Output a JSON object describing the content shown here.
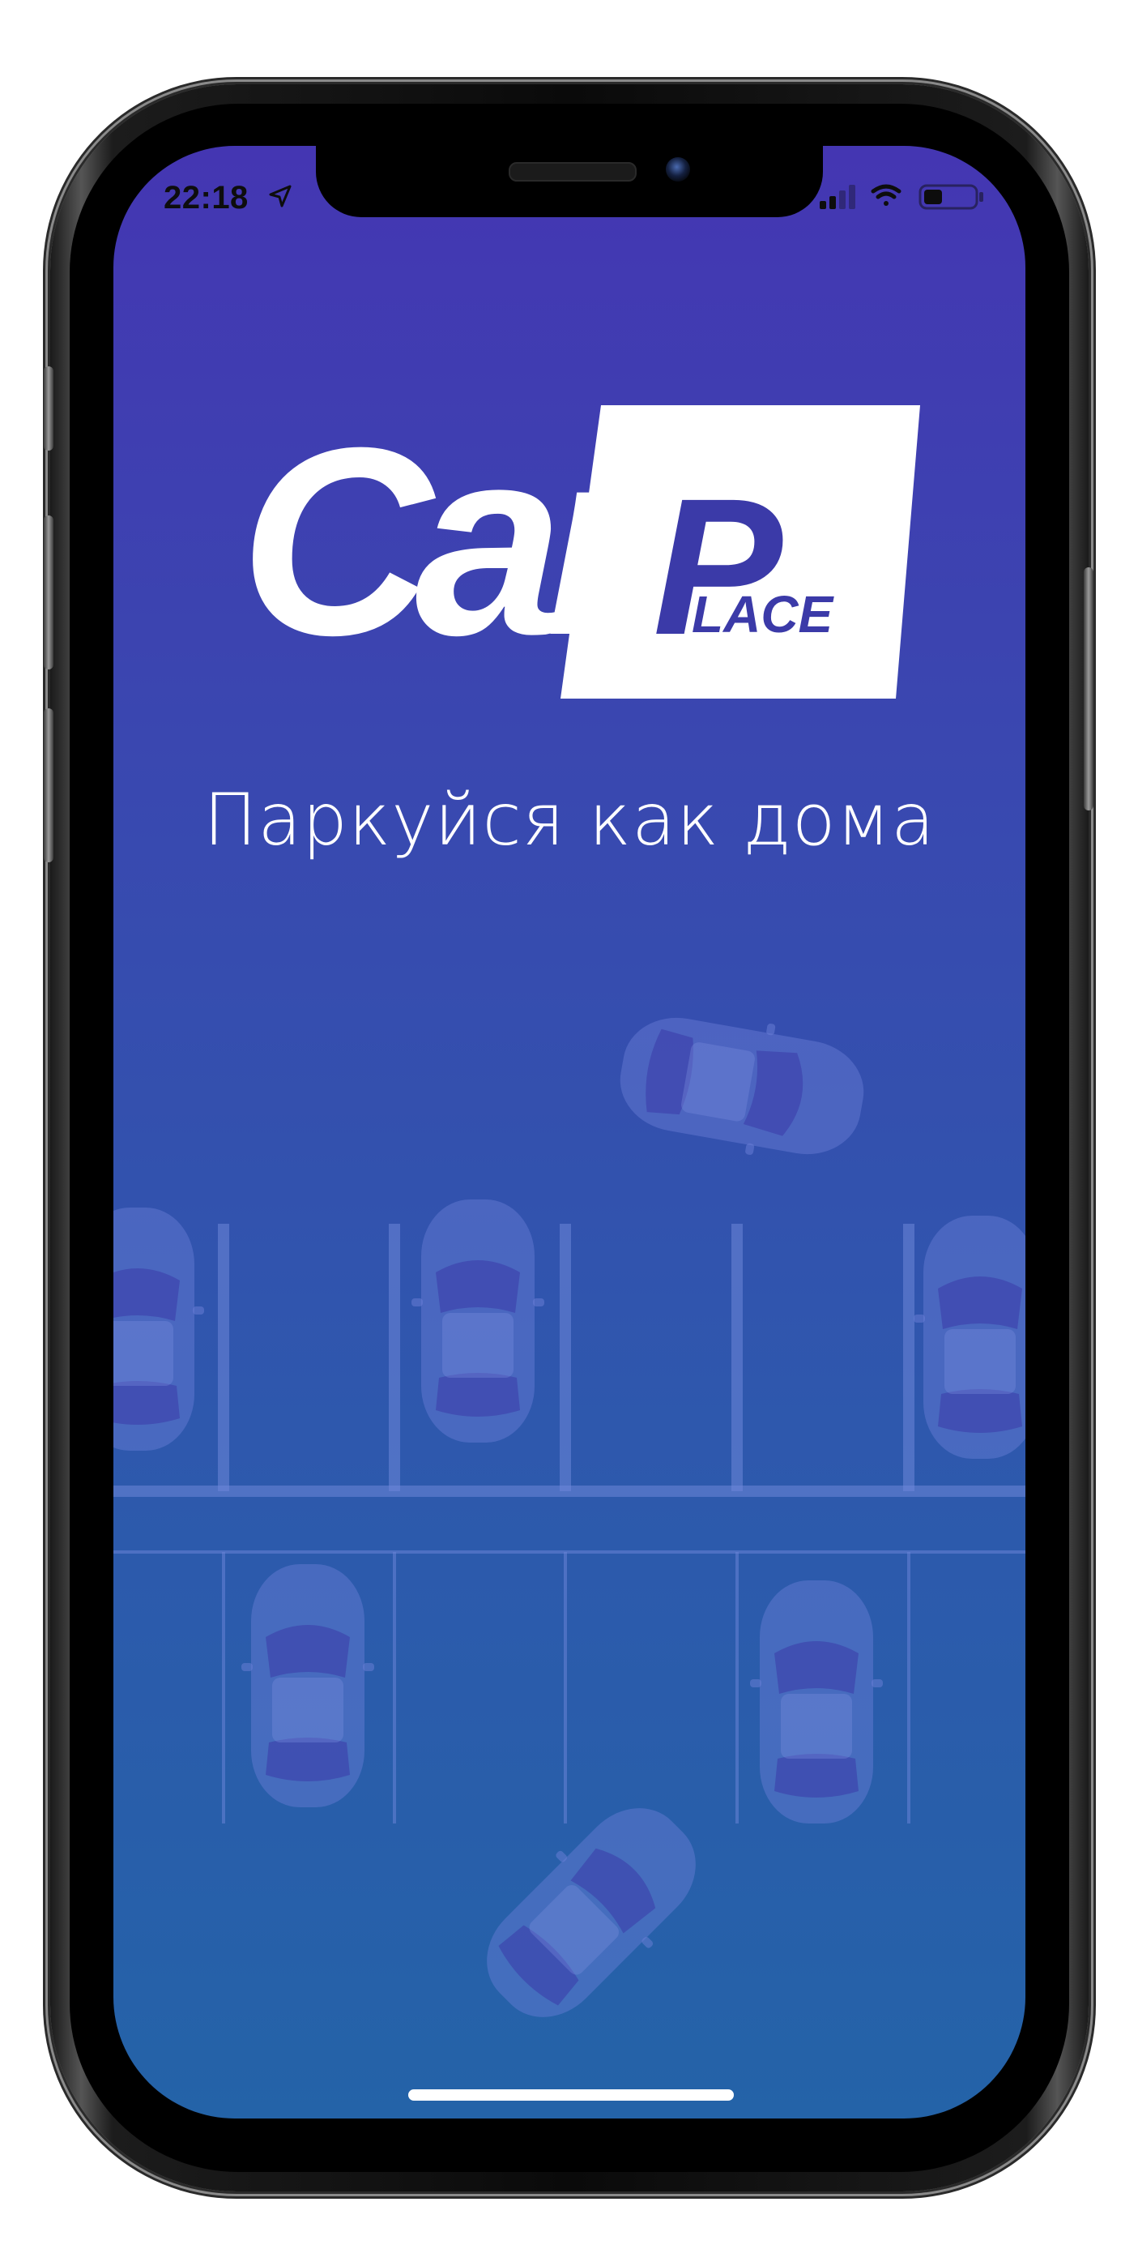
{
  "status_bar": {
    "time": "22:18",
    "location_icon": "location-arrow-icon",
    "signal_icon": "cellular-signal-icon",
    "wifi_icon": "wifi-icon",
    "battery_icon": "battery-low-icon"
  },
  "splash": {
    "logo_car": "Car",
    "logo_p": "P",
    "logo_lace": "LACE",
    "tagline": "Паркуйся как дома"
  },
  "colors": {
    "gradient_top": "#4436b2",
    "gradient_bottom": "#2463a8",
    "logo_white": "#ffffff",
    "logo_blue": "#3b3aa8"
  }
}
